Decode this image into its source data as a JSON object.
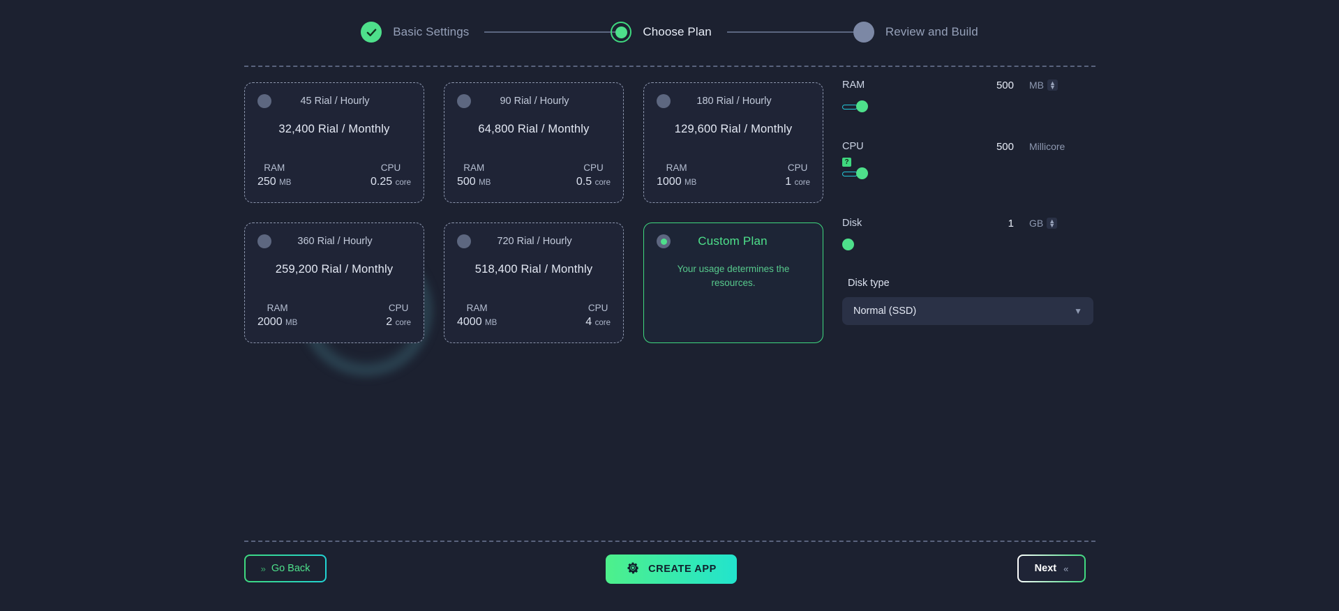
{
  "stepper": {
    "steps": [
      {
        "label": "Basic Settings",
        "state": "done",
        "icon": "check-icon"
      },
      {
        "label": "Choose Plan",
        "state": "active",
        "icon": "current-step-icon"
      },
      {
        "label": "Review and Build",
        "state": "todo",
        "icon": "pending-step-icon"
      }
    ]
  },
  "plans": [
    {
      "hourly": "45 Rial / Hourly",
      "monthly": "32,400 Rial / Monthly",
      "ram_label": "RAM",
      "ram_value": "250",
      "ram_unit": "MB",
      "cpu_label": "CPU",
      "cpu_value": "0.25",
      "cpu_unit": "core",
      "selected": false
    },
    {
      "hourly": "90 Rial / Hourly",
      "monthly": "64,800 Rial / Monthly",
      "ram_label": "RAM",
      "ram_value": "500",
      "ram_unit": "MB",
      "cpu_label": "CPU",
      "cpu_value": "0.5",
      "cpu_unit": "core",
      "selected": false
    },
    {
      "hourly": "180 Rial / Hourly",
      "monthly": "129,600 Rial / Monthly",
      "ram_label": "RAM",
      "ram_value": "1000",
      "ram_unit": "MB",
      "cpu_label": "CPU",
      "cpu_value": "1",
      "cpu_unit": "core",
      "selected": false
    },
    {
      "hourly": "360 Rial / Hourly",
      "monthly": "259,200 Rial / Monthly",
      "ram_label": "RAM",
      "ram_value": "2000",
      "ram_unit": "MB",
      "cpu_label": "CPU",
      "cpu_value": "2",
      "cpu_unit": "core",
      "selected": false
    },
    {
      "hourly": "720 Rial / Hourly",
      "monthly": "518,400 Rial / Monthly",
      "ram_label": "RAM",
      "ram_value": "4000",
      "ram_unit": "MB",
      "cpu_label": "CPU",
      "cpu_value": "4",
      "cpu_unit": "core",
      "selected": false
    }
  ],
  "custom_plan": {
    "title": "Custom Plan",
    "subtitle": "Your usage determines the resources.",
    "selected": true
  },
  "resources": {
    "ram": {
      "label": "RAM",
      "value": "500",
      "unit": "MB",
      "slider_percent": 7
    },
    "cpu": {
      "label": "CPU",
      "value": "500",
      "unit": "Millicore",
      "slider_percent": 7,
      "help_icon": "question-badge-icon"
    },
    "disk": {
      "label": "Disk",
      "value": "1",
      "unit": "GB",
      "slider_percent": 0
    },
    "disk_type": {
      "label": "Disk type",
      "value": "Normal (SSD)"
    }
  },
  "footer": {
    "go_back": "Go Back",
    "create_app": "CREATE APP",
    "next": "Next"
  },
  "colors": {
    "background": "#1c2130",
    "card": "#1f2436",
    "accent_green": "#4ee08b",
    "accent_cyan": "#22e4cd",
    "dashed_border": "#8d97ae",
    "muted_text": "#8e99b1"
  }
}
